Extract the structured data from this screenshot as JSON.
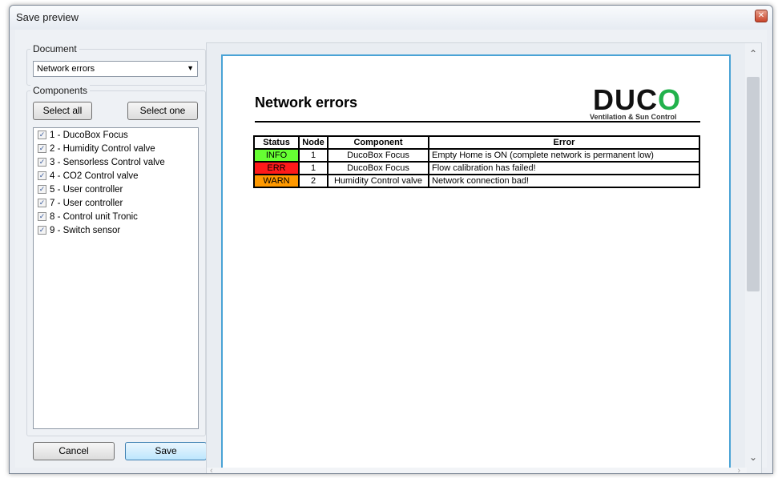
{
  "window": {
    "title": "Save preview"
  },
  "document_group": {
    "label": "Document",
    "selected": "Network errors"
  },
  "components_group": {
    "label": "Components",
    "select_all_label": "Select all",
    "select_one_label": "Select one",
    "items": [
      {
        "label": "1 - DucoBox Focus",
        "checked": true
      },
      {
        "label": "2 - Humidity Control valve",
        "checked": true
      },
      {
        "label": "3 - Sensorless Control valve",
        "checked": true
      },
      {
        "label": "4 - CO2 Control valve",
        "checked": true
      },
      {
        "label": "5 - User controller",
        "checked": true
      },
      {
        "label": "7 - User controller",
        "checked": true
      },
      {
        "label": "8 - Control unit Tronic",
        "checked": true
      },
      {
        "label": "9 - Switch sensor",
        "checked": true
      }
    ]
  },
  "footer": {
    "cancel_label": "Cancel",
    "save_label": "Save"
  },
  "preview": {
    "title": "Network errors",
    "logo_main": "DUC",
    "logo_o": "O",
    "logo_tagline": "Ventilation & Sun Control",
    "table": {
      "headers": [
        "Status",
        "Node",
        "Component",
        "Error"
      ],
      "rows": [
        {
          "status": "INFO",
          "status_color": "#66ff33",
          "node": "1",
          "component": "DucoBox Focus",
          "error": "Empty Home is ON (complete network is permanent low)"
        },
        {
          "status": "ERR",
          "status_color": "#ff1a1a",
          "node": "1",
          "component": "DucoBox Focus",
          "error": "Flow calibration has failed!"
        },
        {
          "status": "WARN",
          "status_color": "#ff9900",
          "node": "2",
          "component": "Humidity Control valve",
          "error": "Network connection bad!"
        }
      ]
    }
  },
  "colors": {
    "accent_border": "#4aa3d6",
    "logo_green": "#22b24c"
  }
}
